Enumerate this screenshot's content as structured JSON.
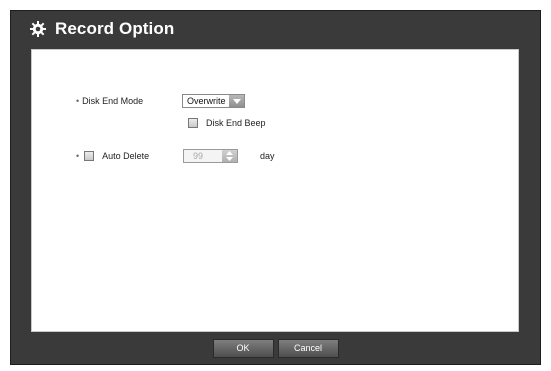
{
  "dialog": {
    "title": "Record Option",
    "icon": "gear-icon"
  },
  "settings": {
    "disk_end_mode": {
      "label": "Disk End Mode",
      "value": "Overwrite"
    },
    "disk_end_beep": {
      "label": "Disk End Beep",
      "checked": false
    },
    "auto_delete": {
      "label": "Auto Delete",
      "checked": false,
      "value": "99",
      "unit": "day"
    }
  },
  "buttons": {
    "ok": "OK",
    "cancel": "Cancel"
  },
  "colors": {
    "frame": "#3a3a3a",
    "panel": "#ffffff",
    "button": "#5e5e5e"
  }
}
